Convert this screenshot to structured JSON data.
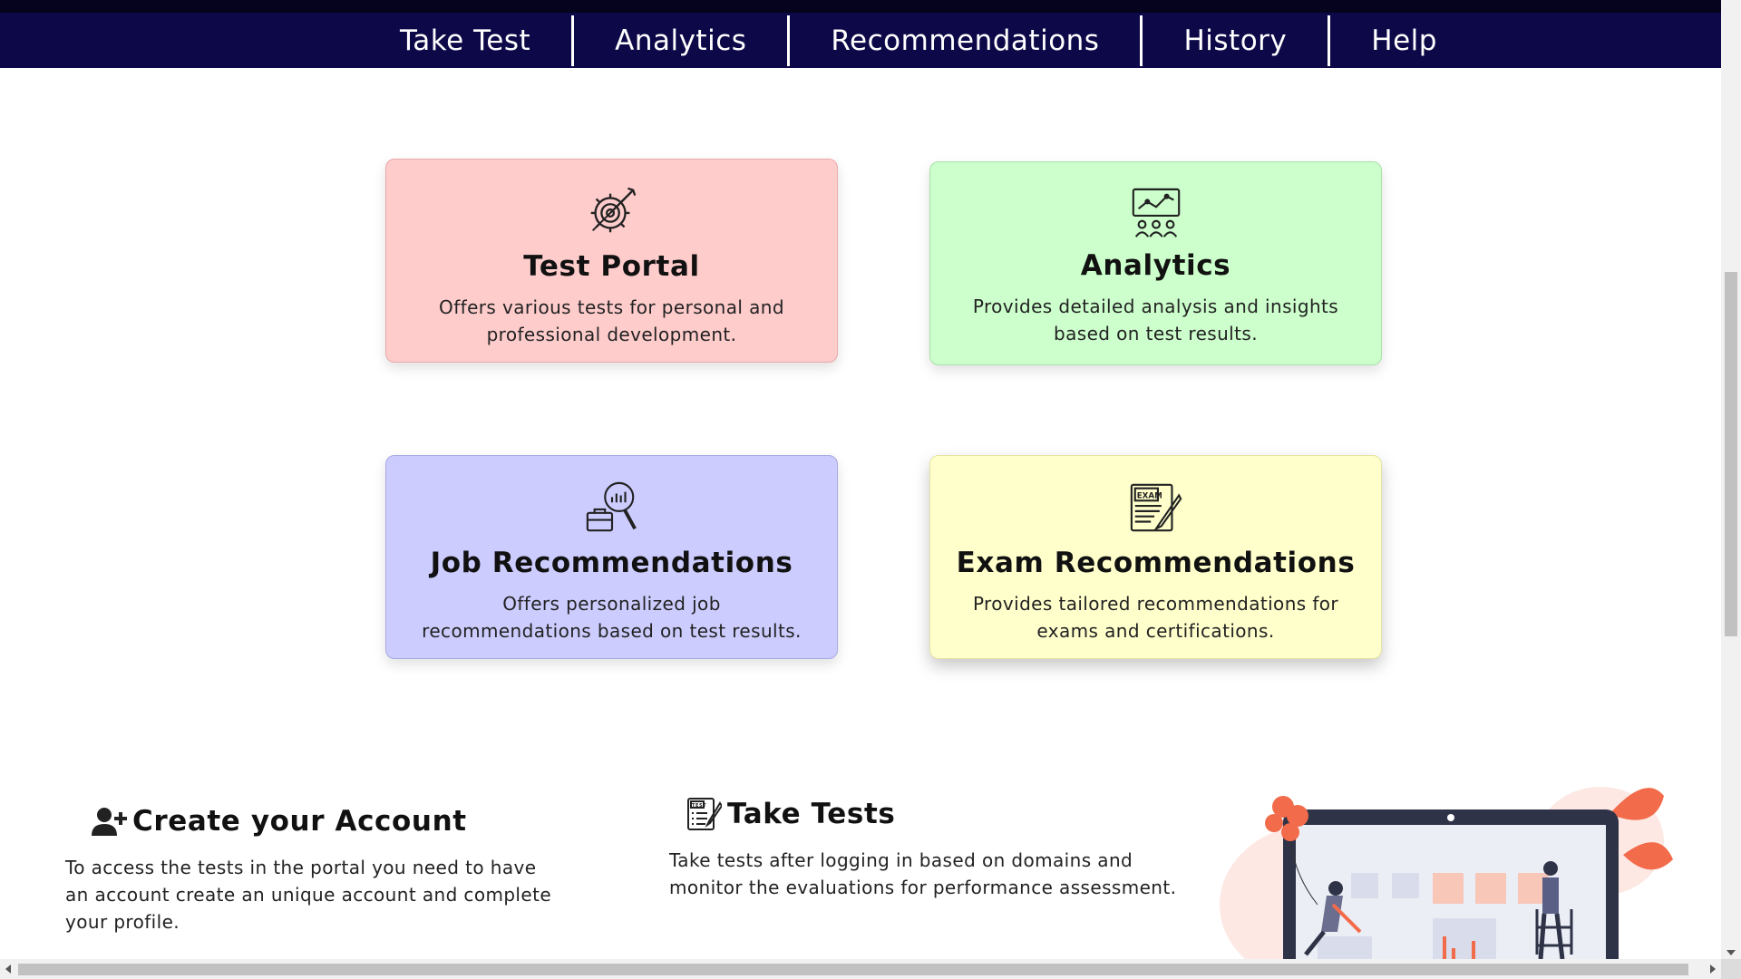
{
  "nav": {
    "items": [
      {
        "label": "Take Test"
      },
      {
        "label": "Analytics"
      },
      {
        "label": "Recommendations"
      },
      {
        "label": "History"
      },
      {
        "label": "Help"
      }
    ]
  },
  "cards": [
    {
      "title": "Test Portal",
      "description": "Offers various tests for personal and professional development.",
      "icon": "gear-target-icon",
      "color": "#ffcccc"
    },
    {
      "title": "Analytics",
      "description": "Provides detailed analysis and insights based on test results.",
      "icon": "chart-people-icon",
      "color": "#ccffcc"
    },
    {
      "title": "Job Recommendations",
      "description": "Offers personalized job recommendations based on test results.",
      "icon": "briefcase-search-icon",
      "color": "#ccccff"
    },
    {
      "title": "Exam Recommendations",
      "description": "Provides tailored recommendations for exams and certifications.",
      "icon": "exam-paper-icon",
      "color": "#ffffcc",
      "icon_text": "EXAM"
    }
  ],
  "steps": [
    {
      "title": "Create your Account",
      "description": "To access the tests in the portal you need to have an account create an unique account and complete your profile.",
      "icon": "user-plus-icon"
    },
    {
      "title": "Take Tests",
      "description": "Take tests after logging in based on domains and monitor the evaluations for performance assessment.",
      "icon": "test-checklist-icon",
      "icon_text": "TEST"
    }
  ],
  "colors": {
    "nav_bg": "#0d0848",
    "accent_orange": "#f26b4a",
    "laptop_dark": "#2f3347"
  }
}
